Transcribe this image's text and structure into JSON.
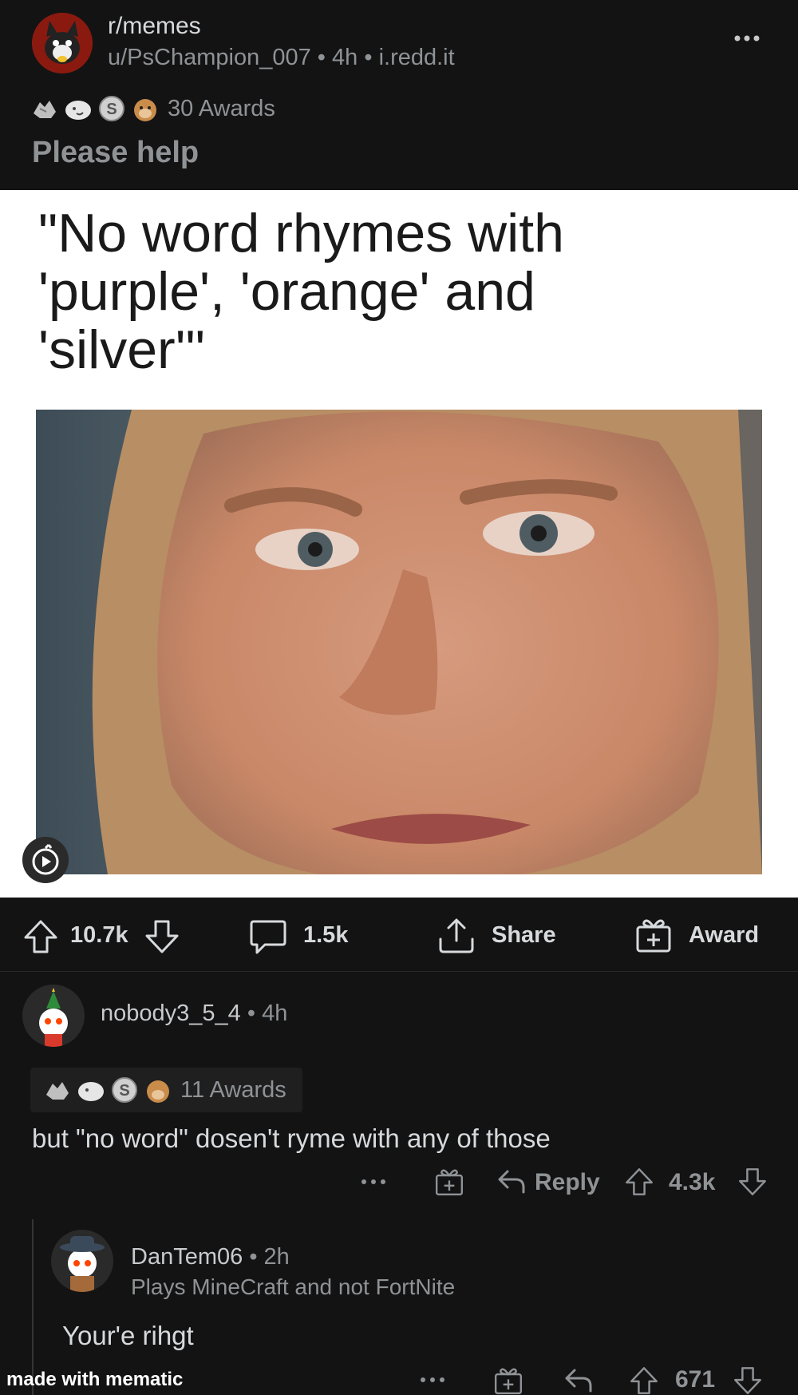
{
  "post": {
    "subreddit": "r/memes",
    "author": "u/PsChampion_007",
    "age": "4h",
    "domain": "i.redd.it",
    "awards_label": "30 Awards",
    "title": "Please help",
    "meme_text": "\"No word rhymes with 'purple', 'orange' and 'silver'\"",
    "upvotes": "10.7k",
    "comments": "1.5k",
    "share_label": "Share",
    "award_label": "Award"
  },
  "comment1": {
    "author": "nobody3_5_4",
    "age": "4h",
    "awards_label": "11 Awards",
    "body": "but \"no word\" dosen't ryme with any of those",
    "reply_label": "Reply",
    "score": "4.3k"
  },
  "comment2": {
    "author": "DanTem06",
    "age": "2h",
    "flair": "Plays MineCraft and not FortNite",
    "body": "Your'e rihgt",
    "score": "671"
  },
  "watermark": "made with mematic",
  "colors": {
    "background": "#131314",
    "text": "#d7dadc",
    "muted": "#8f9396",
    "accent": "#ff4500"
  }
}
